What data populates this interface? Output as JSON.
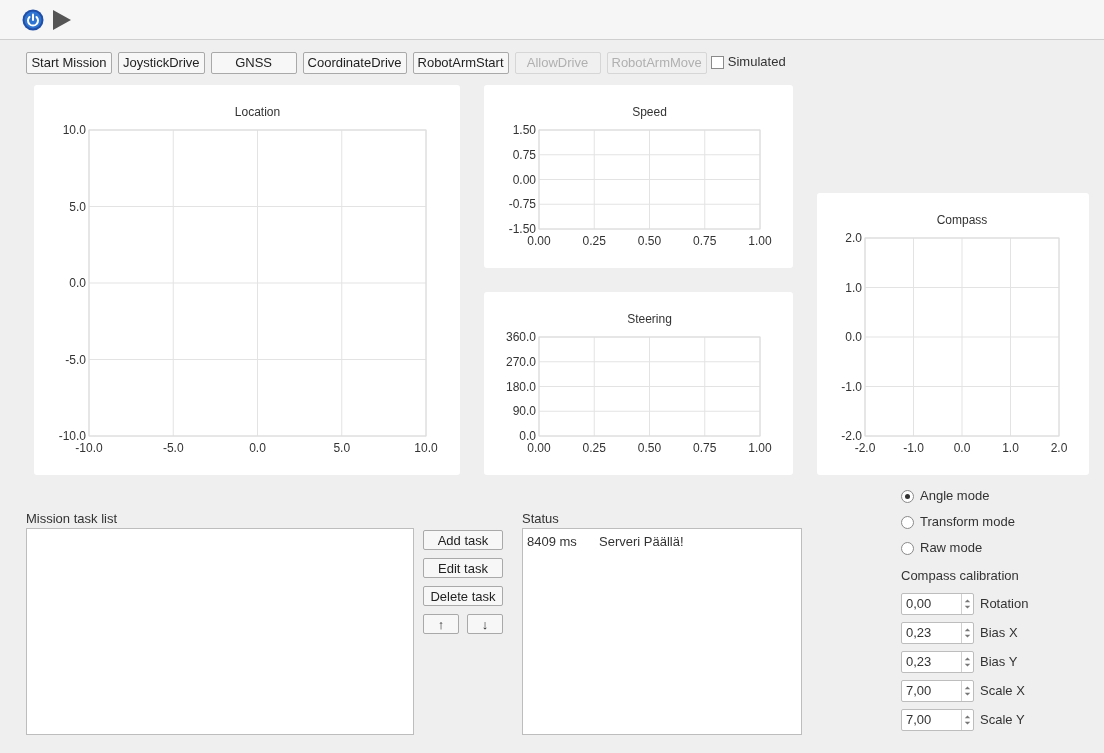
{
  "toolbar": {
    "buttons": [
      {
        "kind": "power"
      },
      {
        "kind": "play"
      }
    ]
  },
  "actions": [
    {
      "label": "Start Mission",
      "disabled": false
    },
    {
      "label": "JoystickDrive",
      "disabled": false
    },
    {
      "label": "GNSS",
      "disabled": false
    },
    {
      "label": "CoordinateDrive",
      "disabled": false
    },
    {
      "label": "RobotArmStart",
      "disabled": false
    },
    {
      "label": "AllowDrive",
      "disabled": true
    },
    {
      "label": "RobotArmMove",
      "disabled": true
    }
  ],
  "simulated": {
    "label": "Simulated",
    "checked": false
  },
  "charts": [
    {
      "chart_data": {
        "type": "line",
        "grid": true,
        "title": "Location",
        "xlim": [
          -10,
          10
        ],
        "ylim": [
          -10,
          10
        ],
        "xticks": [
          {
            "value": -10,
            "label": "-10.0"
          },
          {
            "value": -5,
            "label": "-5.0"
          },
          {
            "value": 0,
            "label": "0.0"
          },
          {
            "value": 5,
            "label": "5.0"
          },
          {
            "value": 10,
            "label": "10.0"
          }
        ],
        "yticks": [
          {
            "value": -10,
            "label": "-10.0"
          },
          {
            "value": -5,
            "label": "-5.0"
          },
          {
            "value": 0,
            "label": "0.0"
          },
          {
            "value": 5,
            "label": "5.0"
          },
          {
            "value": 10,
            "label": "10.0"
          }
        ]
      }
    },
    {
      "chart_data": {
        "type": "line",
        "grid": true,
        "title": "Speed",
        "xlim": [
          0,
          1
        ],
        "ylim": [
          -1.5,
          1.5
        ],
        "xticks": [
          {
            "value": 0,
            "label": "0.00"
          },
          {
            "value": 0.25,
            "label": "0.25"
          },
          {
            "value": 0.5,
            "label": "0.50"
          },
          {
            "value": 0.75,
            "label": "0.75"
          },
          {
            "value": 1,
            "label": "1.00"
          }
        ],
        "yticks": [
          {
            "value": -1.5,
            "label": "-1.50"
          },
          {
            "value": -0.75,
            "label": "-0.75"
          },
          {
            "value": 0,
            "label": "0.00"
          },
          {
            "value": 0.75,
            "label": "0.75"
          },
          {
            "value": 1.5,
            "label": "1.50"
          }
        ]
      }
    },
    {
      "chart_data": {
        "type": "line",
        "grid": true,
        "title": "Steering",
        "xlim": [
          0,
          1
        ],
        "ylim": [
          0,
          360
        ],
        "xticks": [
          {
            "value": 0,
            "label": "0.00"
          },
          {
            "value": 0.25,
            "label": "0.25"
          },
          {
            "value": 0.5,
            "label": "0.50"
          },
          {
            "value": 0.75,
            "label": "0.75"
          },
          {
            "value": 1,
            "label": "1.00"
          }
        ],
        "yticks": [
          {
            "value": 0,
            "label": "0.0"
          },
          {
            "value": 90,
            "label": "90.0"
          },
          {
            "value": 180,
            "label": "180.0"
          },
          {
            "value": 270,
            "label": "270.0"
          },
          {
            "value": 360,
            "label": "360.0"
          }
        ]
      }
    },
    {
      "chart_data": {
        "type": "line",
        "grid": true,
        "title": "Compass",
        "xlim": [
          -2,
          2
        ],
        "ylim": [
          -2,
          2
        ],
        "xticks": [
          {
            "value": -2,
            "label": "-2.0"
          },
          {
            "value": -1,
            "label": "-1.0"
          },
          {
            "value": 0,
            "label": "0.0"
          },
          {
            "value": 1,
            "label": "1.0"
          },
          {
            "value": 2,
            "label": "2.0"
          }
        ],
        "yticks": [
          {
            "value": -2,
            "label": "-2.0"
          },
          {
            "value": -1,
            "label": "-1.0"
          },
          {
            "value": 0,
            "label": "0.0"
          },
          {
            "value": 1,
            "label": "1.0"
          },
          {
            "value": 2,
            "label": "2.0"
          }
        ]
      }
    }
  ],
  "mission_task_list": {
    "title": "Mission task list"
  },
  "task_buttons": [
    {
      "label": "Add task"
    },
    {
      "label": "Edit task"
    },
    {
      "label": "Delete task"
    }
  ],
  "move_buttons": [
    {
      "label": "↑"
    },
    {
      "label": "↓"
    }
  ],
  "status": {
    "title": "Status",
    "entries": [
      {
        "time": "8409 ms",
        "message": "Serveri Päällä!"
      }
    ]
  },
  "modes": [
    {
      "label": "Angle mode",
      "selected": true
    },
    {
      "label": "Transform mode",
      "selected": false
    },
    {
      "label": "Raw mode",
      "selected": false
    }
  ],
  "calibration": {
    "title": "Compass calibration",
    "fields": [
      {
        "value": "0,00",
        "label": "Rotation"
      },
      {
        "value": "0,23",
        "label": "Bias X"
      },
      {
        "value": "0,23",
        "label": "Bias Y"
      },
      {
        "value": "7,00",
        "label": "Scale X"
      },
      {
        "value": "7,00",
        "label": "Scale Y"
      }
    ]
  }
}
